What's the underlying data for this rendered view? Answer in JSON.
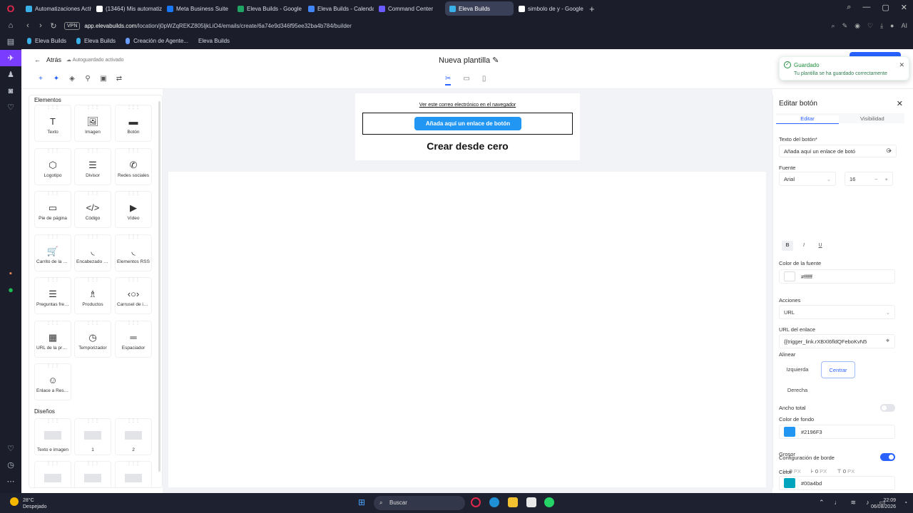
{
  "browser": {
    "tabs": [
      {
        "label": "Automatizaciones Activas",
        "color": "#3ab0e8"
      },
      {
        "label": "(13464) Mis automatizacio",
        "color": "#ffffff"
      },
      {
        "label": "Meta Business Suite",
        "color": "#1877f2"
      },
      {
        "label": "Eleva Builds - Google Drive",
        "color": "#1fa463"
      },
      {
        "label": "Eleva Builds - Calendar - S",
        "color": "#4285f4"
      },
      {
        "label": "Command Center",
        "color": "#6b5cff"
      },
      {
        "label": "Eleva Builds",
        "color": "#3ab0e8"
      },
      {
        "label": "simbolo de y - Google Se",
        "color": "#ffffff"
      }
    ],
    "vpn": "VPN",
    "url_host": "app.elevabuilds.com",
    "url_path": "/location/j0pWZqREKZ805ljkLiO4/emails/create/6a74e9d346f95ee32ba4b784/builder",
    "bookmarks": [
      "Eleva Builds",
      "Eleva Builds",
      "Creación de Agente...",
      "Eleva Builds"
    ],
    "ai_label": "AI"
  },
  "header": {
    "back": "Atrás",
    "autosave": "Autoguardado activado",
    "title": "Nueva plantilla",
    "toast_title": "Guardado",
    "toast_msg": "Tu plantilla se ha guardado correctamente"
  },
  "elements": {
    "title": "Elementos",
    "items": [
      {
        "label": "Texto",
        "icon": "T"
      },
      {
        "label": "Imagen",
        "icon": "🖼"
      },
      {
        "label": "Botón",
        "icon": "▬"
      },
      {
        "label": "Logotipo",
        "icon": "⬡"
      },
      {
        "label": "Divisor",
        "icon": "☰"
      },
      {
        "label": "Redes sociales",
        "icon": "✆"
      },
      {
        "label": "Pie de página",
        "icon": "▭"
      },
      {
        "label": "Código",
        "icon": "</>"
      },
      {
        "label": "Vídeo",
        "icon": "▶"
      },
      {
        "label": "Carrito de la compra",
        "icon": "🛒"
      },
      {
        "label": "Encabezado RSS",
        "icon": "◟"
      },
      {
        "label": "Elementos RSS",
        "icon": "◟"
      },
      {
        "label": "Preguntas frecuentes",
        "icon": "☰"
      },
      {
        "label": "Productos",
        "icon": "♗"
      },
      {
        "label": "Carrusel de imágenes",
        "icon": "‹○›"
      },
      {
        "label": "URL de la prueba",
        "icon": "▦"
      },
      {
        "label": "Temporizador",
        "icon": "◷"
      },
      {
        "label": "Espaciador",
        "icon": "═"
      },
      {
        "label": "Enlace a Reseñas",
        "icon": "☺"
      }
    ],
    "layouts_title": "Diseños",
    "layouts": [
      "Texto e imagen",
      "1",
      "2"
    ]
  },
  "email": {
    "view_link": "Ver este correo electrónico en el navegador",
    "button_text": "Añada aquí un enlace de botón",
    "heading": "Crear desde cero"
  },
  "editor": {
    "title": "Editar botón",
    "tab_edit": "Editar",
    "tab_visibility": "Visibilidad",
    "button_text_label": "Texto del botón*",
    "button_text_value": "Añada aquí un enlace de botó",
    "font_label": "Fuente",
    "font_value": "Arial",
    "font_size": "16",
    "bold": "B",
    "italic": "I",
    "underline": "U",
    "font_color_label": "Color de la fuente",
    "font_color": "#ffffff",
    "actions_label": "Acciones",
    "actions_value": "URL",
    "link_label": "URL del enlace",
    "link_value": "{{trigger_link.rXBXl6fldQFeboKvN5",
    "align_label": "Alinear",
    "align_left": "Izquierda",
    "align_center": "Centrar",
    "align_right": "Derecha",
    "full_width_label": "Ancho total",
    "bg_color_label": "Color de fondo",
    "bg_color": "#2196F3",
    "border_label": "Configuración de borde",
    "border_color_label": "Color",
    "border_color": "#00a4bd",
    "thickness_label": "Grosor",
    "thickness_values": [
      "0",
      "0",
      "0"
    ],
    "px": "PX"
  },
  "taskbar": {
    "temp": "28°C",
    "weather": "Despejado",
    "search": "Buscar",
    "time": "22:09",
    "date": "06/08/2026"
  }
}
